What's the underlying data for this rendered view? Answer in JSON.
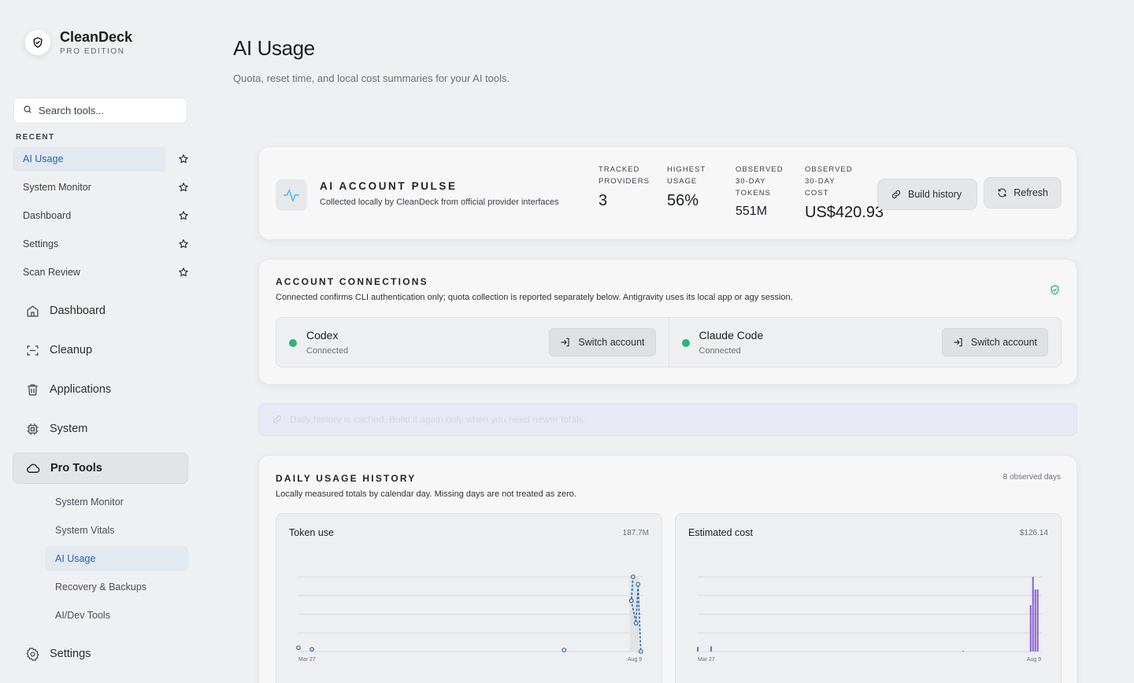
{
  "brand": {
    "name": "CleanDeck",
    "edition": "PRO EDITION"
  },
  "search": {
    "placeholder": "Search tools..."
  },
  "recent": {
    "label": "RECENT",
    "items": [
      {
        "label": "AI Usage"
      },
      {
        "label": "System Monitor"
      },
      {
        "label": "Dashboard"
      },
      {
        "label": "Settings"
      },
      {
        "label": "Scan Review"
      }
    ]
  },
  "nav": {
    "items": [
      {
        "label": "Dashboard",
        "icon": "home-icon"
      },
      {
        "label": "Cleanup",
        "icon": "scan-icon"
      },
      {
        "label": "Applications",
        "icon": "trash-icon"
      },
      {
        "label": "System",
        "icon": "cpu-icon"
      },
      {
        "label": "Pro Tools",
        "icon": "cloud-icon"
      }
    ],
    "sub_items": [
      {
        "label": "System Monitor"
      },
      {
        "label": "System Vitals"
      },
      {
        "label": "AI Usage"
      },
      {
        "label": "Recovery & Backups"
      },
      {
        "label": "AI/Dev Tools"
      }
    ],
    "settings": {
      "label": "Settings",
      "icon": "gear-icon"
    }
  },
  "page": {
    "title": "AI Usage",
    "subtitle": "Quota, reset time, and local cost summaries for your AI tools."
  },
  "pulse": {
    "title": "AI ACCOUNT PULSE",
    "subtitle": "Collected locally by CleanDeck from official provider interfaces",
    "stats": [
      {
        "label_lines": [
          "TRACKED",
          "PROVIDERS"
        ],
        "value": "3"
      },
      {
        "label_lines": [
          "HIGHEST",
          "USAGE"
        ],
        "value": "56%"
      },
      {
        "label_lines": [
          "OBSERVED",
          "30-DAY",
          "TOKENS"
        ],
        "value": "551M"
      },
      {
        "label_lines": [
          "OBSERVED",
          "30-DAY",
          "COST"
        ],
        "value": "US$420.93"
      }
    ],
    "build_history_label": "Build history",
    "refresh_label": "Refresh"
  },
  "connections": {
    "title": "ACCOUNT CONNECTIONS",
    "subtitle": "Connected confirms CLI authentication only; quota collection is reported separately below. Antigravity uses its local app or agy session.",
    "accounts": [
      {
        "name": "Codex",
        "status": "Connected",
        "button": "Switch account"
      },
      {
        "name": "Claude Code",
        "status": "Connected",
        "button": "Switch account"
      }
    ],
    "status_color": "#2fb177"
  },
  "notice": {
    "text": "Daily history is cached. Build it again only when you need newer totals."
  },
  "history": {
    "title": "DAILY USAGE HISTORY",
    "subtitle": "Locally measured totals by calendar day. Missing days are not treated as zero.",
    "observed": "8 observed days"
  },
  "chart_data": [
    {
      "type": "line",
      "title": "Token use",
      "total": "187.7M",
      "x_tick_labels": [
        "Mar 27",
        "Aug 9"
      ],
      "series_color": "#2f6aa8",
      "points": [
        {
          "x": 0.0,
          "y": 0.05
        },
        {
          "x": 0.04,
          "y": 0.03
        },
        {
          "x": 0.79,
          "y": 0.02
        },
        {
          "x": 0.995,
          "y": 1.0
        },
        {
          "x": 0.99,
          "y": 0.68
        },
        {
          "x": 1.004,
          "y": 0.38
        },
        {
          "x": 1.01,
          "y": 0.9
        },
        {
          "x": 1.018,
          "y": 0.0
        }
      ]
    },
    {
      "type": "bar",
      "title": "Estimated cost",
      "total": "$126.14",
      "x_tick_labels": [
        "Mar 27",
        "Aug 9"
      ],
      "series_color": "#8a5fd6",
      "bars": [
        {
          "x": 0.0,
          "v": 0.06
        },
        {
          "x": 0.04,
          "v": 0.07
        },
        {
          "x": 0.79,
          "v": 0.01
        },
        {
          "x": 0.99,
          "v": 0.62
        },
        {
          "x": 0.997,
          "v": 1.0
        },
        {
          "x": 1.004,
          "v": 0.83
        },
        {
          "x": 1.011,
          "v": 0.83
        }
      ]
    }
  ]
}
